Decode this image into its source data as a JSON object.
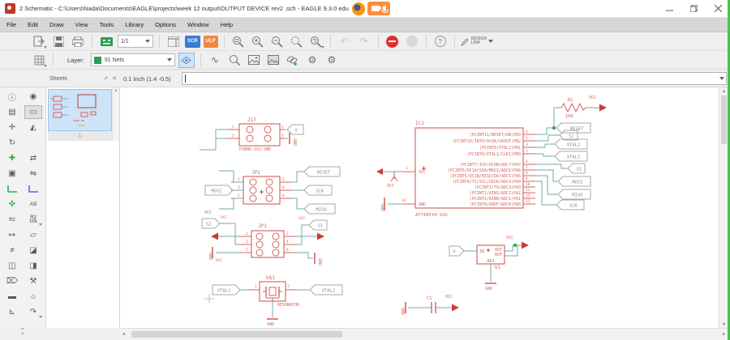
{
  "window": {
    "title": "2 Schematic - C:\\Users\\Nada\\Documents\\EAGLE\\projects\\week 12 output\\OUTPUT DEVICE rev2 .sch - EAGLE 9.3.0 edu"
  },
  "menu": {
    "items": [
      "File",
      "Edit",
      "Draw",
      "View",
      "Tools",
      "Library",
      "Options",
      "Window",
      "Help"
    ]
  },
  "toolbar": {
    "sheet_select": "1/1",
    "scr": "SCR",
    "ulp": "ULP",
    "help": "?",
    "design_link_line1": "DESIGN",
    "design_link_line2": "LINK"
  },
  "layerbar": {
    "label": "Layer:",
    "selected": "91 Nets",
    "swatch_color": "#2e9e4e"
  },
  "subbar": {
    "sheets_title": "Sheets",
    "coordinates": "0.1 inch (1.4 -0.5)",
    "command_value": ""
  },
  "sheets": {
    "sheet_number": "1"
  },
  "palette": {
    "name_tool": "R2",
    "value_tool_top": "R2",
    "value_tool_bottom": "10k",
    "label_tool": "AB"
  },
  "schematic": {
    "j17": {
      "name": "J17",
      "value": "PINHD-2X2-SMD",
      "pin1": "1",
      "pin2": "2",
      "pin3": "3",
      "pin4": "4"
    },
    "jp2": {
      "name": "JP2",
      "pin1": "1",
      "pin2": "2",
      "pin3": "3",
      "pin4": "4",
      "pin5": "5",
      "pin6": "6"
    },
    "jp1": {
      "name": "JP1",
      "pin1": "1",
      "pin2": "2",
      "pin3": "3",
      "pin4": "4",
      "pin5": "5",
      "pin6": "6"
    },
    "xtal": {
      "name": "U$1",
      "value": "RESONATOR",
      "pin1": "1",
      "pin3": "3"
    },
    "r1": {
      "name": "R1",
      "value": "10K"
    },
    "c1": {
      "name": "C1"
    },
    "u1": {
      "name": "U1",
      "pin_in": "IN",
      "pin_out1": "OUT",
      "pin_out2": "OUT",
      "pin_adj": "ADJ"
    },
    "ic1": {
      "name": "IC1",
      "value": "ATTINY44-SSU",
      "vcc_label": "VCC",
      "gnd_label": "GND",
      "pin1_num": "1",
      "pin14_num": "14",
      "right_pins": [
        {
          "num": "4",
          "label": "(PCINT11/RESET/DW)PB3"
        },
        {
          "num": "5",
          "label": "(PCINT10/INT0/OC0A/CKOUT)PB2"
        },
        {
          "num": "3",
          "label": "(PCINT9/XTAL2)PB1"
        },
        {
          "num": "2",
          "label": "(PCINT8/XTAL1/CLKI)PB0"
        },
        {
          "num": "6",
          "label": "(PCINT7/ICP/OC0B/ADC7)PA7"
        },
        {
          "num": "7",
          "label": "(PCINT6/OC1A/SDA/MOSI/ADC6)PA6"
        },
        {
          "num": "8",
          "label": "(PCINT5/OC1B/MISO/DO/ADC5)PA5"
        },
        {
          "num": "9",
          "label": "(PCINT4/T1/SCL/USCK/ADC4)PA4"
        },
        {
          "num": "10",
          "label": "(PCINT3/T0/ADC3)PA3"
        },
        {
          "num": "11",
          "label": "(PCINT2/AIN1/ADC2)PA2"
        },
        {
          "num": "12",
          "label": "(PCINT1/AIN0/ADC1)PA1"
        },
        {
          "num": "13",
          "label": "(PCINT0/AREF/ADC0)PA0"
        }
      ]
    },
    "flags": {
      "v_j17": "V",
      "jp2_reset": "RESET",
      "jp2_sck": "SCK",
      "jp2_miso": "MISO",
      "jp2_mosi": "MOSI",
      "jp1_s2": "S2",
      "jp1_s1": "S1",
      "res_xtal1": "XTAL1",
      "res_xtal2": "XTAL2",
      "ic_reset": "RESET",
      "ic_s2": "S2",
      "ic_xtal2": "XTAL2",
      "ic_xtal1": "XTAL1",
      "ic_s1": "S1",
      "ic_mosi": "MOSI",
      "ic_miso": "MISO",
      "ic_sck": "SCK",
      "u1_v": "V"
    },
    "supplies": {
      "vcc": "VCC",
      "gnd": "GND"
    }
  }
}
